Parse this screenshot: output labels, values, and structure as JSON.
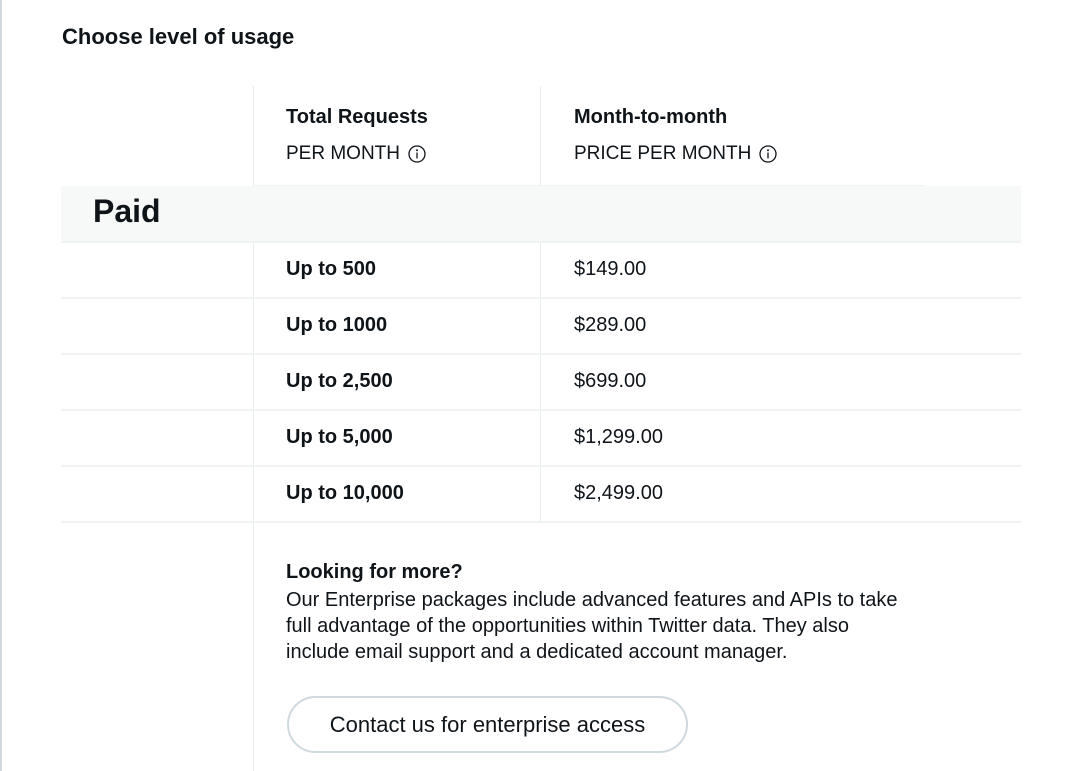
{
  "heading": "Choose level of usage",
  "columns": {
    "requests": {
      "title": "Total Requests",
      "subtitle": "PER MONTH"
    },
    "price": {
      "title": "Month-to-month",
      "subtitle": "PRICE PER MONTH"
    }
  },
  "tier_label": "Paid",
  "rows": [
    {
      "requests": "Up to 500",
      "price": "$149.00"
    },
    {
      "requests": "Up to 1000",
      "price": "$289.00"
    },
    {
      "requests": "Up to 2,500",
      "price": "$699.00"
    },
    {
      "requests": "Up to 5,000",
      "price": "$1,299.00"
    },
    {
      "requests": "Up to 10,000",
      "price": "$2,499.00"
    }
  ],
  "enterprise": {
    "title": "Looking for more?",
    "body": "Our Enterprise packages include advanced features and APIs to take full advantage of the opportunities within Twitter data. They also include email support and a dedicated account manager.",
    "button_label": "Contact us for enterprise access"
  },
  "icons": {
    "column_info": "info-icon"
  },
  "colors": {
    "text": "#0f1419",
    "border": "#cfd9de",
    "band": "#f7f9f9"
  }
}
